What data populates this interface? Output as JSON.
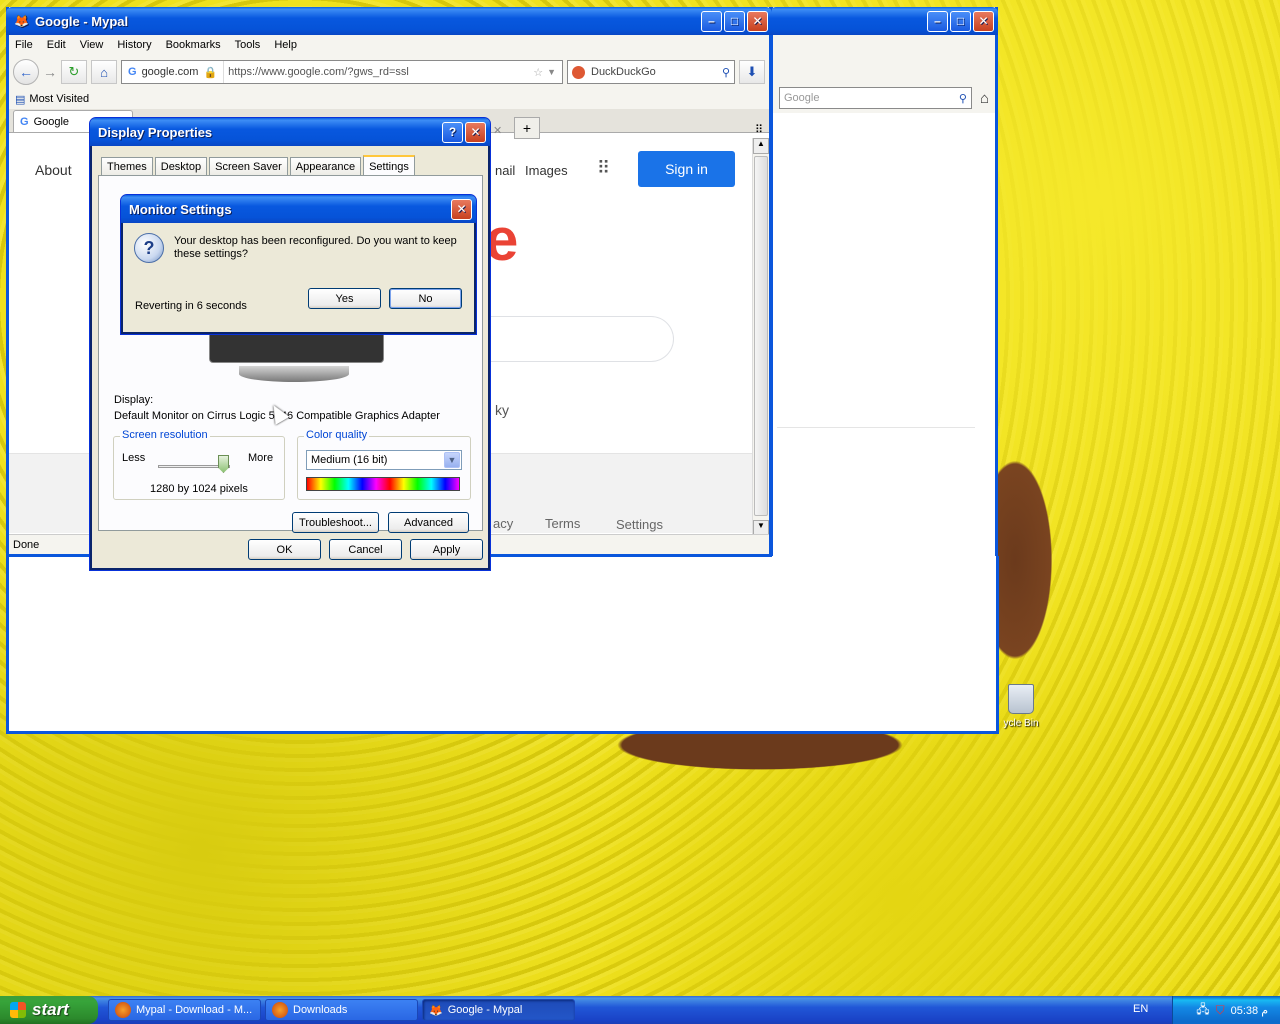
{
  "desktop": {
    "recycle_bin_label": "ycle Bin"
  },
  "browser_back": {
    "search_placeholder": "Google"
  },
  "browser": {
    "title": "Google - Mypal",
    "menu": [
      "File",
      "Edit",
      "View",
      "History",
      "Bookmarks",
      "Tools",
      "Help"
    ],
    "site_identity": "google.com",
    "url": "https://www.google.com/?gws_rd=ssl",
    "search_engine": "DuckDuckGo",
    "bookmarks_label": "Most Visited",
    "tab_title": "Google",
    "status": "Done",
    "page": {
      "about": "About",
      "gmail_partial": "nail",
      "images": "Images",
      "sign_in": "Sign in",
      "lucky_partial": "ky",
      "footer_privacy_partial": "acy",
      "footer_terms": "Terms",
      "footer_settings": "Settings"
    }
  },
  "display_properties": {
    "title": "Display Properties",
    "tabs": [
      "Themes",
      "Desktop",
      "Screen Saver",
      "Appearance",
      "Settings"
    ],
    "active_tab": "Settings",
    "display_label": "Display:",
    "display_value": "Default Monitor on Cirrus Logic 5446 Compatible Graphics Adapter",
    "screen_resolution": {
      "title": "Screen resolution",
      "less": "Less",
      "more": "More",
      "value": "1280 by 1024 pixels",
      "slider_position": 1.0
    },
    "color_quality": {
      "title": "Color quality",
      "selected": "Medium (16 bit)"
    },
    "buttons": {
      "troubleshoot": "Troubleshoot...",
      "advanced": "Advanced",
      "ok": "OK",
      "cancel": "Cancel",
      "apply": "Apply"
    }
  },
  "monitor_settings": {
    "title": "Monitor Settings",
    "message": "Your desktop has been reconfigured.  Do you want to keep these settings?",
    "countdown": "Reverting in 6 seconds",
    "yes": "Yes",
    "no": "No"
  },
  "taskbar": {
    "start": "start",
    "tasks": [
      "Mypal - Download - M...",
      "Downloads",
      "Google - Mypal"
    ],
    "language": "EN",
    "clock": "05:38 م"
  },
  "colors": {
    "xp_title_blue": "#0858df",
    "google_signin_blue": "#1a73e8",
    "google_red": "#ea4335",
    "taskbar_green": "#37a43a"
  }
}
